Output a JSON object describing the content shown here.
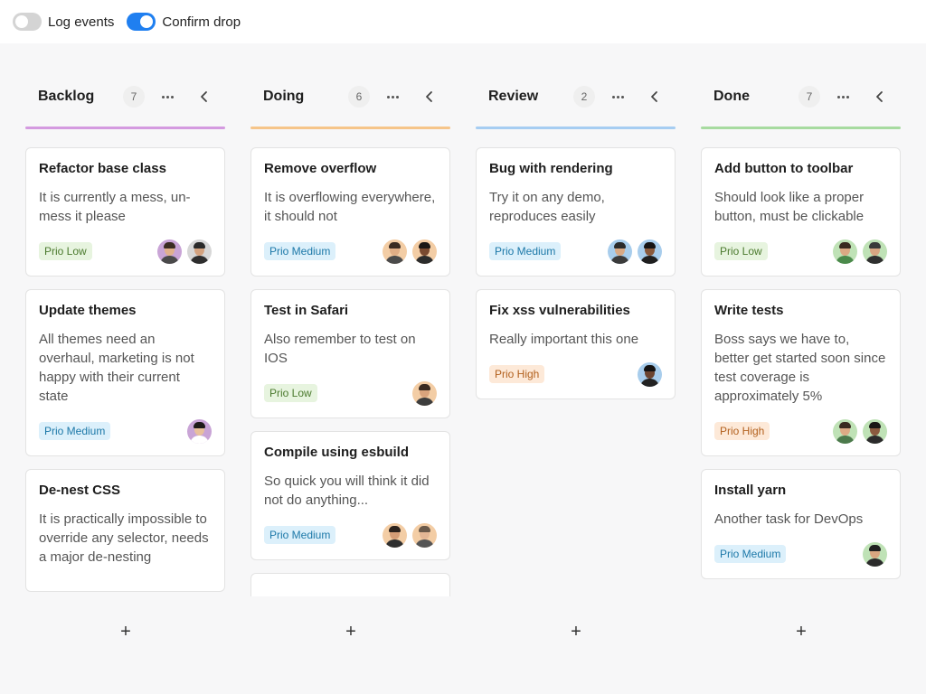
{
  "toolbar": {
    "log_events": {
      "label": "Log events",
      "on": false
    },
    "confirm_drop": {
      "label": "Confirm drop",
      "on": true
    }
  },
  "colors": {
    "accent": "#1f7ff0",
    "backlog": "#d49ae0",
    "doing": "#f6c58a",
    "review": "#a6cdf2",
    "done": "#a7dba0"
  },
  "columns": [
    {
      "title": "Backlog",
      "count": "7",
      "color": "#d49ae0",
      "add_label": "+",
      "cards": [
        {
          "title": "Refactor base class",
          "desc": "It is currently a mess, un-mess it please",
          "prio": "Prio Low",
          "level": "low",
          "avatars": [
            {
              "bg": "#c9a4d6",
              "hair": "#3b2c22",
              "face": "#e0b08c",
              "body": "#4a4a4a"
            },
            {
              "bg": "#d7d7d7",
              "hair": "#2a2a2a",
              "face": "#d3a27f",
              "body": "#2e2e2e"
            }
          ]
        },
        {
          "title": "Update themes",
          "desc": "All themes need an overhaul, marketing is not happy with their current state",
          "prio": "Prio Medium",
          "level": "medium",
          "avatars": [
            {
              "bg": "#c9a4d6",
              "hair": "#1e1a18",
              "face": "#e8c09c",
              "body": "#ffffff"
            }
          ]
        },
        {
          "title": "De-nest CSS",
          "desc": "It is practically impossible to override any selector, needs a major de-nesting",
          "prio": "",
          "level": "",
          "avatars": []
        }
      ]
    },
    {
      "title": "Doing",
      "count": "6",
      "color": "#f6c58a",
      "add_label": "+",
      "cards": [
        {
          "title": "Remove overflow",
          "desc": "It is overflowing everywhere, it should not",
          "prio": "Prio Medium",
          "level": "medium",
          "avatars": [
            {
              "bg": "#f3cda5",
              "hair": "#3a2b22",
              "face": "#e0ae86",
              "body": "#4b4b4b"
            },
            {
              "bg": "#f3cda5",
              "hair": "#1a1716",
              "face": "#7a4a30",
              "body": "#2c2c2c"
            }
          ]
        },
        {
          "title": "Test in Safari",
          "desc": "Also remember to test on IOS",
          "prio": "Prio Low",
          "level": "low",
          "avatars": [
            {
              "bg": "#f3cda5",
              "hair": "#3a2b22",
              "face": "#d9a37c",
              "body": "#3d3d3d"
            }
          ]
        },
        {
          "title": "Compile using esbuild",
          "desc": "So quick you will think it did not do anything...",
          "prio": "Prio Medium",
          "level": "medium",
          "avatars": [
            {
              "bg": "#f3cda5",
              "hair": "#2d231d",
              "face": "#d59d76",
              "body": "#2f2f2f"
            },
            {
              "bg": "#f3cda5",
              "hair": "#6b5a4a",
              "face": "#e4b795",
              "body": "#555555"
            }
          ]
        }
      ]
    },
    {
      "title": "Review",
      "count": "2",
      "color": "#a6cdf2",
      "add_label": "+",
      "cards": [
        {
          "title": "Bug with rendering",
          "desc": "Try it on any demo, reproduces easily",
          "prio": "Prio Medium",
          "level": "medium",
          "avatars": [
            {
              "bg": "#a8cdec",
              "hair": "#2b2b2b",
              "face": "#d8a985",
              "body": "#3b3b3b"
            },
            {
              "bg": "#a8cdec",
              "hair": "#161414",
              "face": "#8a5a3c",
              "body": "#1f1f1f"
            }
          ]
        },
        {
          "title": "Fix xss vulnerabilities",
          "desc": "Really important this one",
          "prio": "Prio High",
          "level": "high",
          "avatars": [
            {
              "bg": "#a8cdec",
              "hair": "#151313",
              "face": "#6c4430",
              "body": "#222222"
            }
          ]
        }
      ]
    },
    {
      "title": "Done",
      "count": "7",
      "color": "#a7dba0",
      "add_label": "+",
      "cards": [
        {
          "title": "Add button to toolbar",
          "desc": "Should look like a proper button, must be clickable",
          "prio": "Prio Low",
          "level": "low",
          "avatars": [
            {
              "bg": "#bfe2b6",
              "hair": "#3a2a20",
              "face": "#dba984",
              "body": "#4b8a4b"
            },
            {
              "bg": "#bfe2b6",
              "hair": "#3a3a3a",
              "face": "#d7a582",
              "body": "#2f2f2f"
            }
          ]
        },
        {
          "title": "Write tests",
          "desc": "Boss says we have to, better get started soon since test coverage is approximately 5%",
          "prio": "Prio High",
          "level": "high",
          "avatars": [
            {
              "bg": "#bfe2b6",
              "hair": "#3a2a20",
              "face": "#dcaa85",
              "body": "#4c7a4c"
            },
            {
              "bg": "#bfe2b6",
              "hair": "#1b1716",
              "face": "#8a5a3f",
              "body": "#2b2b2b"
            }
          ]
        },
        {
          "title": "Install yarn",
          "desc": "Another task for DevOps",
          "prio": "Prio Medium",
          "level": "medium",
          "avatars": [
            {
              "bg": "#bfe2b6",
              "hair": "#202020",
              "face": "#d8a680",
              "body": "#2b2b2b"
            }
          ]
        }
      ]
    }
  ]
}
